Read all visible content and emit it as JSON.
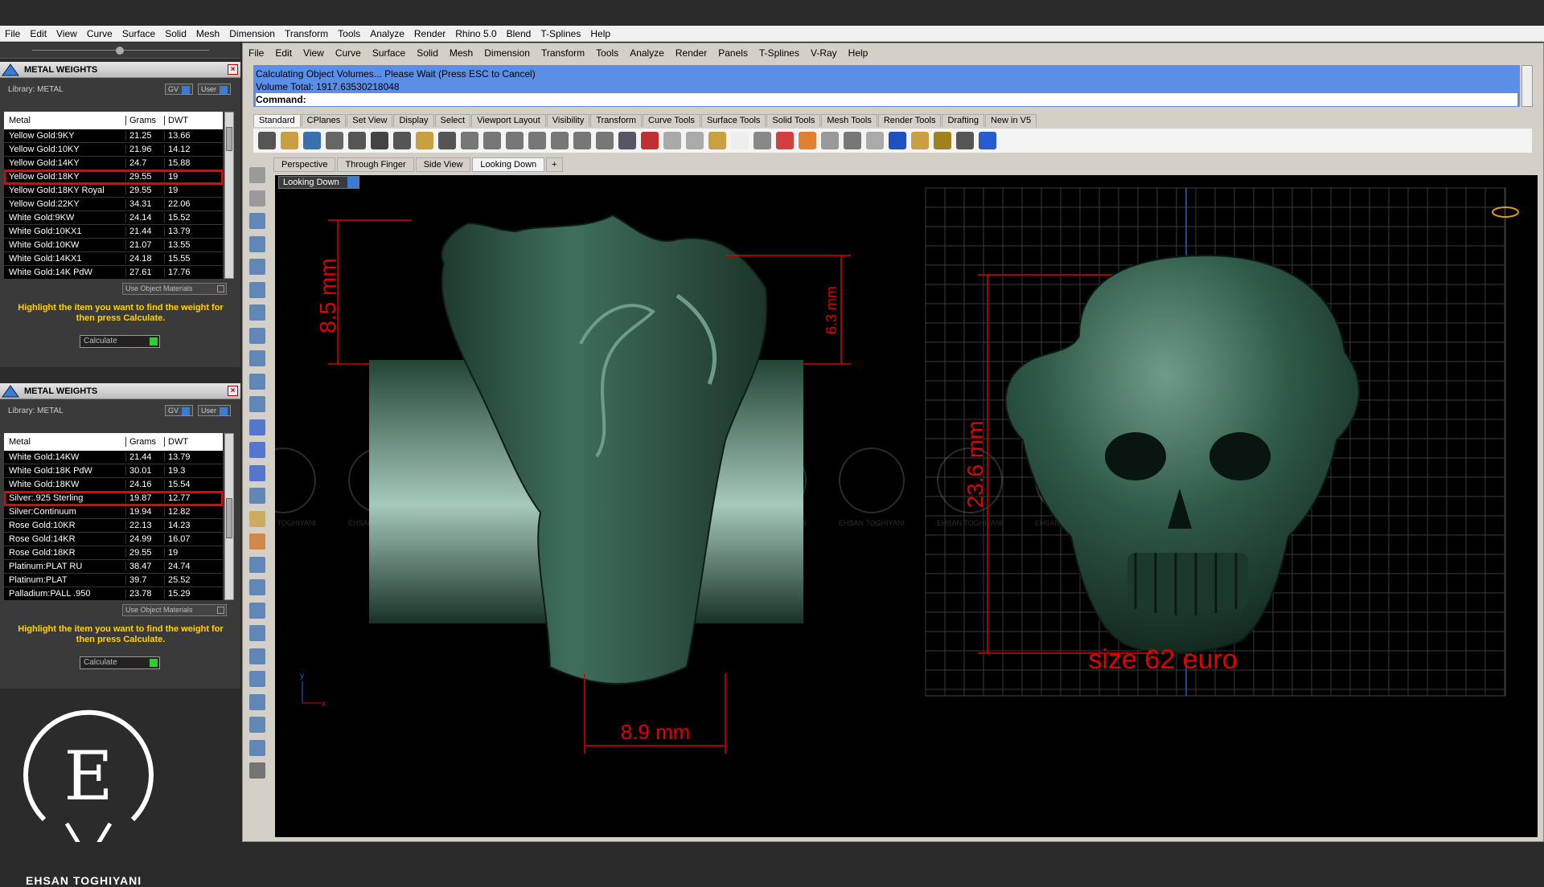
{
  "outer_menu": [
    "File",
    "Edit",
    "View",
    "Curve",
    "Surface",
    "Solid",
    "Mesh",
    "Dimension",
    "Transform",
    "Tools",
    "Analyze",
    "Render",
    "Rhino 5.0",
    "Blend",
    "T-Splines",
    "Help"
  ],
  "metal_panels": [
    {
      "title": "METAL WEIGHTS",
      "library": "Library: METAL",
      "toggle_gv": "GV",
      "toggle_user": "User",
      "headers": [
        "Metal",
        "Grams",
        "DWT"
      ],
      "rows": [
        [
          "Yellow Gold:9KY",
          "21.25",
          "13.66"
        ],
        [
          "Yellow Gold:10KY",
          "21.96",
          "14.12"
        ],
        [
          "Yellow Gold:14KY",
          "24.7",
          "15.88"
        ],
        [
          "Yellow Gold:18KY",
          "29.55",
          "19"
        ],
        [
          "Yellow Gold:18KY Royal",
          "29.55",
          "19"
        ],
        [
          "Yellow Gold:22KY",
          "34.31",
          "22.06"
        ],
        [
          "White Gold:9KW",
          "24.14",
          "15.52"
        ],
        [
          "White Gold:10KX1",
          "21.44",
          "13.79"
        ],
        [
          "White Gold:10KW",
          "21.07",
          "13.55"
        ],
        [
          "White Gold:14KX1",
          "24.18",
          "15.55"
        ],
        [
          "White Gold:14K PdW",
          "27.61",
          "17.76"
        ]
      ],
      "highlight_index": 3,
      "use_object_materials": "Use Object Materials",
      "message": "Highlight the item you want to find the weight for then press Calculate.",
      "calculate": "Calculate"
    },
    {
      "title": "METAL WEIGHTS",
      "library": "Library: METAL",
      "toggle_gv": "GV",
      "toggle_user": "User",
      "headers": [
        "Metal",
        "Grams",
        "DWT"
      ],
      "rows": [
        [
          "White Gold:14KW",
          "21.44",
          "13.79"
        ],
        [
          "White Gold:18K PdW",
          "30.01",
          "19.3"
        ],
        [
          "White Gold:18KW",
          "24.16",
          "15.54"
        ],
        [
          "Silver:.925 Sterling",
          "19.87",
          "12.77"
        ],
        [
          "Silver:Continuum",
          "19.94",
          "12.82"
        ],
        [
          "Rose Gold:10KR",
          "22.13",
          "14.23"
        ],
        [
          "Rose Gold:14KR",
          "24.99",
          "16.07"
        ],
        [
          "Rose Gold:18KR",
          "29.55",
          "19"
        ],
        [
          "Platinum:PLAT RU",
          "38.47",
          "24.74"
        ],
        [
          "Platinum:PLAT",
          "39.7",
          "25.52"
        ],
        [
          "Palladium:PALL .950",
          "23.78",
          "15.29"
        ]
      ],
      "highlight_index": 3,
      "use_object_materials": "Use Object Materials",
      "message": "Highlight the item you want to find the weight for then press Calculate.",
      "calculate": "Calculate"
    }
  ],
  "brand": {
    "letter": "E",
    "name": "EHSAN TOGHIYANI"
  },
  "rhino_menu": [
    "File",
    "Edit",
    "View",
    "Curve",
    "Surface",
    "Solid",
    "Mesh",
    "Dimension",
    "Transform",
    "Tools",
    "Analyze",
    "Render",
    "Panels",
    "T-Splines",
    "V-Ray",
    "Help"
  ],
  "command": {
    "line1": "Calculating Object Volumes... Please Wait (Press ESC to Cancel)",
    "line2": "Volume Total: 1917.63530218048",
    "prompt": "Command:"
  },
  "toolbar_tabs": [
    "Standard",
    "CPlanes",
    "Set View",
    "Display",
    "Select",
    "Viewport Layout",
    "Visibility",
    "Transform",
    "Curve Tools",
    "Surface Tools",
    "Solid Tools",
    "Mesh Tools",
    "Render Tools",
    "Drafting",
    "New in V5"
  ],
  "toolbar_icons": [
    "new-file-icon",
    "open-file-icon",
    "save-icon",
    "print-icon",
    "import-icon",
    "cut-icon",
    "copy-icon",
    "paste-icon",
    "undo-icon",
    "pan-hand-icon",
    "rotate-view-icon",
    "zoom-icon",
    "zoom-window-icon",
    "zoom-extents-icon",
    "zoom-selected-icon",
    "undo-view-icon",
    "four-viewports-icon",
    "car-icon",
    "hide-icon",
    "isolate-icon",
    "points-on-icon",
    "light-icon",
    "lock-icon",
    "layer-icon",
    "color-wheel-icon",
    "material-sphere-icon",
    "render-sphere-icon",
    "shaded-sphere-icon",
    "blue-sphere-icon",
    "select-filter-icon",
    "gear-options-icon",
    "snap-icon",
    "help-icon"
  ],
  "viewport_tabs": [
    "Perspective",
    "Through Finger",
    "Side View",
    "Looking Down"
  ],
  "active_viewport_tab": "Looking Down",
  "viewport_label": "Looking Down",
  "axis": {
    "x": "x",
    "y": "y"
  },
  "dimensions": {
    "a": "8.5 mm",
    "b": "6.3 mm",
    "c": "8.9 mm",
    "d": "23.6 mm"
  },
  "size_note": "size 62 euro",
  "watermark": "EHSAN TOGHIYANI",
  "colors": {
    "dimension_red": "#e00000",
    "command_blue": "#5b8fe6",
    "ring_green": "#2f5a48",
    "message_yellow": "#ffd200"
  }
}
